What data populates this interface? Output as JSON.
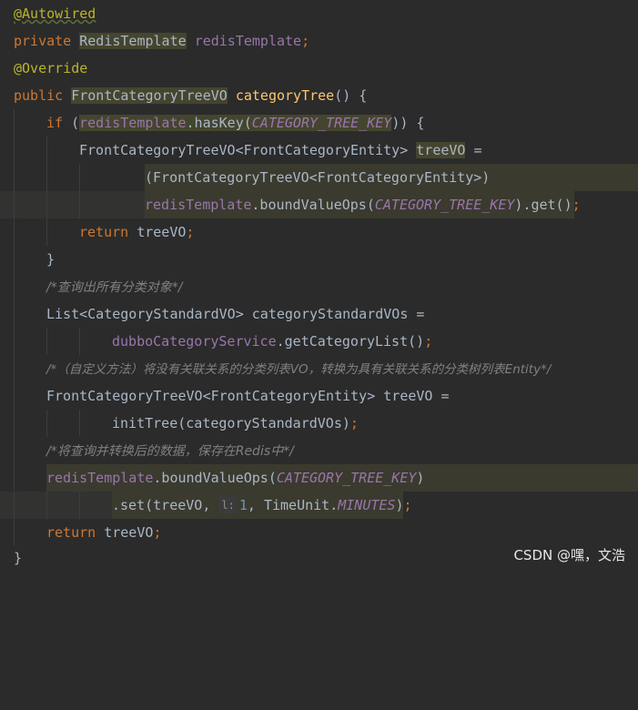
{
  "code": {
    "l1": {
      "annotation": "@Autowired"
    },
    "l2": {
      "kw": "private",
      "type": "RedisTemplate",
      "field": "redisTemplate",
      "semi": ";"
    },
    "l3": {
      "annotation": "@Override"
    },
    "l4": {
      "kw": "public",
      "type": "FrontCategoryTreeVO",
      "method": "categoryTree",
      "rest": "() {"
    },
    "l5": {
      "kw": "if",
      "open": "(",
      "field": "redisTemplate",
      "dot": ".hasKey(",
      "const": "CATEGORY_TREE_KEY",
      "close": ")) {"
    },
    "l6": {
      "decl": "FrontCategoryTreeVO<FrontCategoryEntity>",
      "var": "treeVO",
      "eq": " ="
    },
    "l7": {
      "cast": "(FrontCategoryTreeVO<FrontCategoryEntity>)"
    },
    "l8": {
      "field": "redisTemplate",
      "call": ".boundValueOps(",
      "const": "CATEGORY_TREE_KEY",
      "tail": ").get()",
      "semi": ";"
    },
    "l9": {
      "kw": "return",
      "rest": " treeVO",
      "semi": ";"
    },
    "l10": {
      "text": "}"
    },
    "l11": {
      "comment": "/*查询出所有分类对象*/"
    },
    "l12": {
      "text": "List<CategoryStandardVO> categoryStandardVOs ="
    },
    "l13": {
      "field": "dubboCategoryService",
      "rest": ".getCategoryList()",
      "semi": ";"
    },
    "l14": {
      "comment": "/*（自定义方法）将没有关联关系的分类列表VO，转换为具有关联关系的分类树列表Entity*/"
    },
    "l15": {
      "text": "FrontCategoryTreeVO<FrontCategoryEntity> treeVO ="
    },
    "l16": {
      "text": "initTree(categoryStandardVOs)",
      "semi": ";"
    },
    "l17": {
      "comment": "/*将查询并转换后的数据，保存在Redis中*/"
    },
    "l18": {
      "field": "redisTemplate",
      "call": ".boundValueOps(",
      "const": "CATEGORY_TREE_KEY",
      "close": ")"
    },
    "l19": {
      "pre": ".set(treeVO, ",
      "hint": "l:",
      "num": "1",
      "mid": ", TimeUnit.",
      "const": "MINUTES",
      "close": ")",
      "semi": ";"
    },
    "l20": {
      "kw": "return",
      "rest": " treeVO",
      "semi": ";"
    },
    "l21": {
      "text": "}"
    }
  },
  "watermark": "CSDN @嘿，文浩",
  "colors": {
    "background": "#2b2b2b",
    "keyword": "#cc7832",
    "annotation": "#bbb529",
    "field": "#9876aa",
    "method": "#ffc66d",
    "number": "#6897bb",
    "comment": "#808080",
    "text": "#a9b7c6",
    "highlight": "#3b3a2f"
  }
}
